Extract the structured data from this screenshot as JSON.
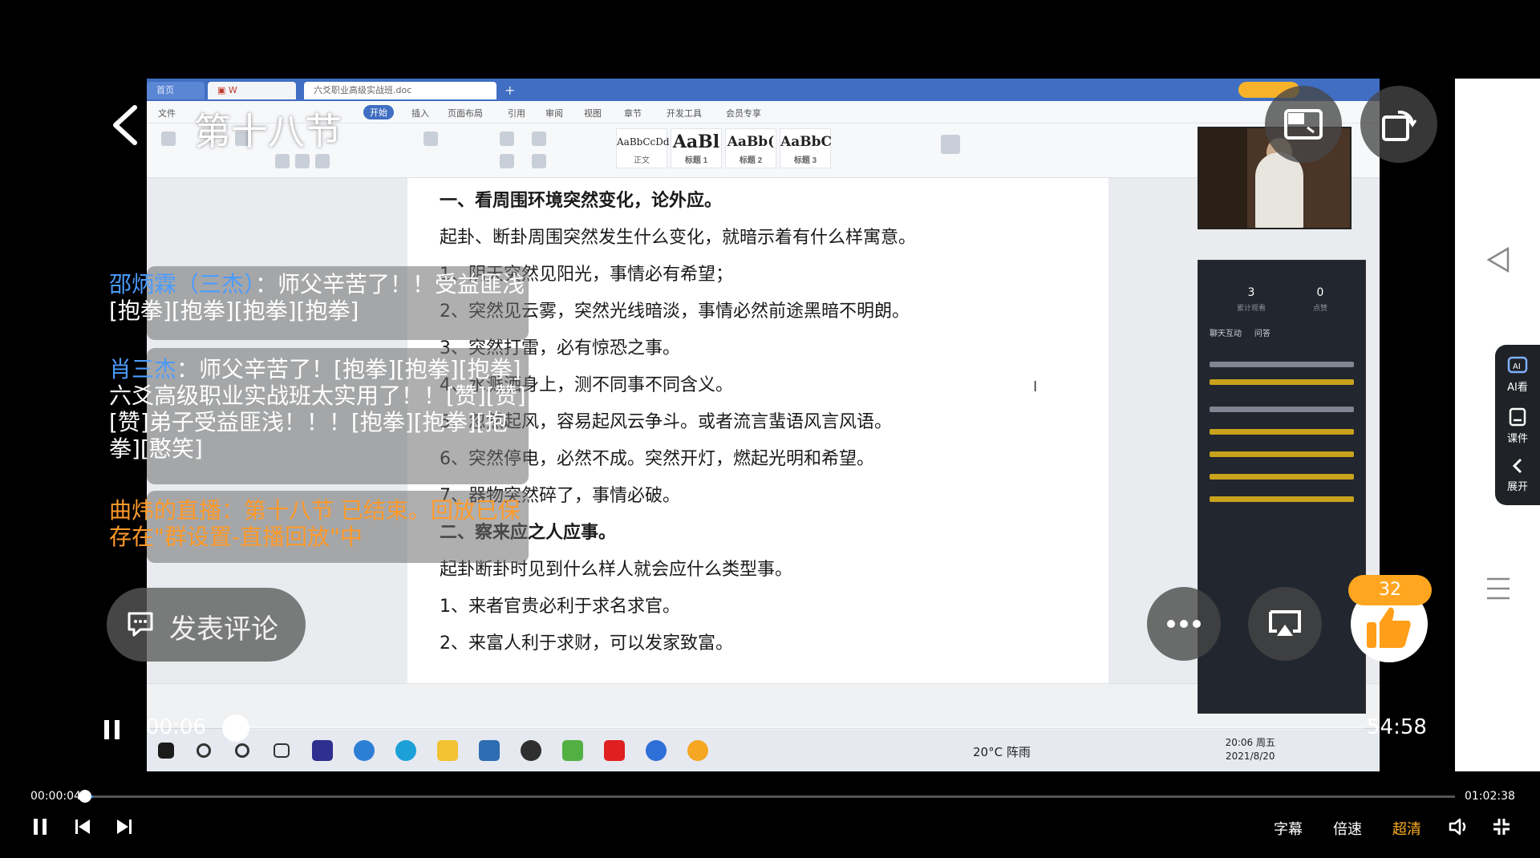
{
  "player": {
    "title": "第十八节",
    "time_current": "00:06",
    "time_total": "54:58",
    "outer_time_current": "00:00:04",
    "outer_time_total": "01:02:38",
    "like_count": "32",
    "comment_placeholder": "发表评论",
    "controls": {
      "subtitle": "字幕",
      "speed": "倍速",
      "quality": "超清"
    }
  },
  "comments": [
    {
      "user": "邵炳霖（三杰）",
      "text": "：师父辛苦了！！受益匪浅[抱拳][抱拳][抱拳][抱拳]"
    },
    {
      "user": "肖三杰",
      "text": "：师父辛苦了！[抱拳][抱拳][抱拳]六爻高级职业实战班太实用了！！[赞][赞][赞]弟子受益匪浅！！！[抱拳][抱拳][抱拳][憨笑]"
    }
  ],
  "system_message": "曲炜的直播：第十八节 已结束。回放已保存在\"群设置-直播回放\"中",
  "side_panel": [
    {
      "label": "AI看"
    },
    {
      "label": "课件"
    },
    {
      "label": "展开"
    }
  ],
  "document": {
    "tab_home": "首页",
    "tab_doc": "六爻职业高级实战班.doc",
    "menu": [
      "文件",
      "开始",
      "插入",
      "页面布局",
      "引用",
      "审阅",
      "视图",
      "章节",
      "开发工具",
      "会员专享"
    ],
    "styles": [
      {
        "preview": "AaBbCcDd",
        "name": "正文"
      },
      {
        "preview": "AaBl",
        "name": "标题 1"
      },
      {
        "preview": "AaBb(",
        "name": "标题 2"
      },
      {
        "preview": "AaBbC",
        "name": "标题 3"
      }
    ],
    "lines": [
      {
        "text": "一、看周围环境突然变化，论外应。",
        "bold": true
      },
      {
        "text": "起卦、断卦周围突然发生什么变化，就暗示着有什么样寓意。",
        "bold": false
      },
      {
        "text": "1、阴天突然见阳光，事情必有希望；",
        "bold": false
      },
      {
        "text": "2、突然见云雾，突然光线暗淡，事情必然前途黑暗不明朗。",
        "bold": false
      },
      {
        "text": "3、突然打雷，必有惊恐之事。",
        "bold": false
      },
      {
        "text": "4、水溅洒身上，测不同事不同含义。",
        "bold": false
      },
      {
        "text": "5、忽然起风，容易起风云争斗。或者流言蜚语风言风语。",
        "bold": false
      },
      {
        "text": "6、突然停电，必然不成。突然开灯，燃起光明和希望。",
        "bold": false
      },
      {
        "text": "7、器物突然碎了，事情必破。",
        "bold": false
      },
      {
        "text": "二、察来应之人应事。",
        "bold": true
      },
      {
        "text": "起卦断卦时见到什么样人就会应什么类型事。",
        "bold": false
      },
      {
        "text": "1、来者官贵必利于求名求官。",
        "bold": false
      },
      {
        "text": "2、来富人利于求财，可以发家致富。",
        "bold": false
      }
    ],
    "stats": [
      {
        "value": "3",
        "label": "累计观看"
      },
      {
        "value": "0",
        "label": "点赞"
      }
    ],
    "panel_tabs": [
      "聊天互动",
      "问答"
    ],
    "taskbar": {
      "weather": "20°C 阵雨",
      "time": "20:06 周五",
      "date": "2021/8/20"
    }
  }
}
